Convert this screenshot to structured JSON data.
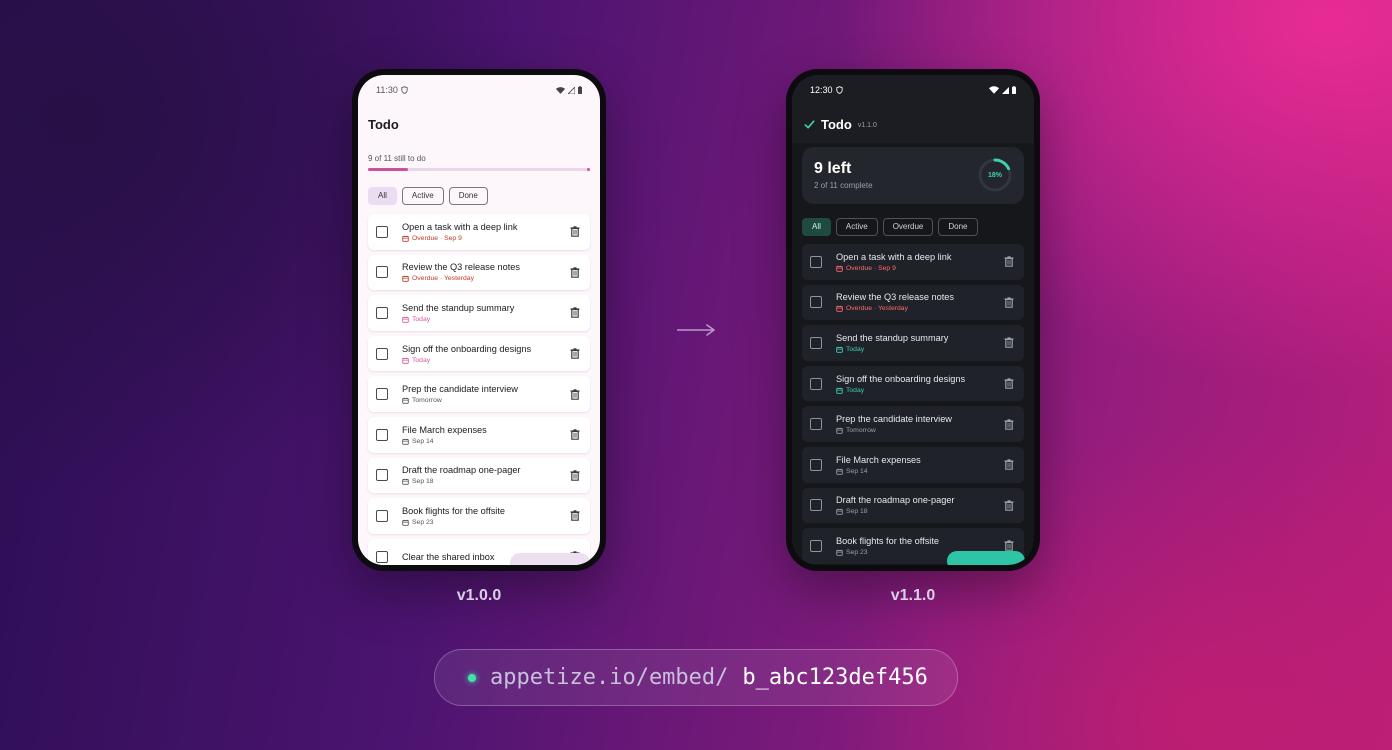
{
  "colors": {
    "accent_light": "#c9529b",
    "overdue_light": "#c0392b",
    "today_light": "#d05a9c",
    "accent_dark": "#3fd0b0",
    "overdue_dark": "#ff6b6b"
  },
  "light": {
    "status_time": "11:30",
    "title": "Todo",
    "subtitle": "9 of 11 still to do",
    "progress": 0.18,
    "filters": [
      "All",
      "Active",
      "Done"
    ],
    "active_filter": 0,
    "tasks": [
      {
        "title": "Open a task with a deep link",
        "due": "Overdue · Sep 9",
        "status": "overdue"
      },
      {
        "title": "Review the Q3 release notes",
        "due": "Overdue · Yesterday",
        "status": "overdue"
      },
      {
        "title": "Send the standup summary",
        "due": "Today",
        "status": "today"
      },
      {
        "title": "Sign off the onboarding designs",
        "due": "Today",
        "status": "today"
      },
      {
        "title": "Prep the candidate interview",
        "due": "Tomorrow",
        "status": "normal"
      },
      {
        "title": "File March expenses",
        "due": "Sep 14",
        "status": "normal"
      },
      {
        "title": "Draft the roadmap one-pager",
        "due": "Sep 18",
        "status": "normal"
      },
      {
        "title": "Book flights for the offsite",
        "due": "Sep 23",
        "status": "normal"
      },
      {
        "title": "Clear the shared inbox",
        "due": "",
        "status": "normal"
      }
    ]
  },
  "dark": {
    "status_time": "12:30",
    "title": "Todo",
    "version": "v1.1.0",
    "left_count": "9 left",
    "complete": "2 of 11 complete",
    "percent": "18%",
    "progress": 0.18,
    "filters": [
      "All",
      "Active",
      "Overdue",
      "Done"
    ],
    "active_filter": 0,
    "tasks": [
      {
        "title": "Open a task with a deep link",
        "due": "Overdue · Sep 9",
        "status": "overdue"
      },
      {
        "title": "Review the Q3 release notes",
        "due": "Overdue · Yesterday",
        "status": "overdue"
      },
      {
        "title": "Send the standup summary",
        "due": "Today",
        "status": "today"
      },
      {
        "title": "Sign off the onboarding designs",
        "due": "Today",
        "status": "today"
      },
      {
        "title": "Prep the candidate interview",
        "due": "Tomorrow",
        "status": "normal"
      },
      {
        "title": "File March expenses",
        "due": "Sep 14",
        "status": "normal"
      },
      {
        "title": "Draft the roadmap one-pager",
        "due": "Sep 18",
        "status": "normal"
      },
      {
        "title": "Book flights for the offsite",
        "due": "Sep 23",
        "status": "normal"
      }
    ]
  },
  "labels": {
    "left_version": "v1.0.0",
    "right_version": "v1.1.0"
  },
  "url": {
    "prefix": "appetize.io/embed/",
    "id": "b_abc123def456"
  }
}
